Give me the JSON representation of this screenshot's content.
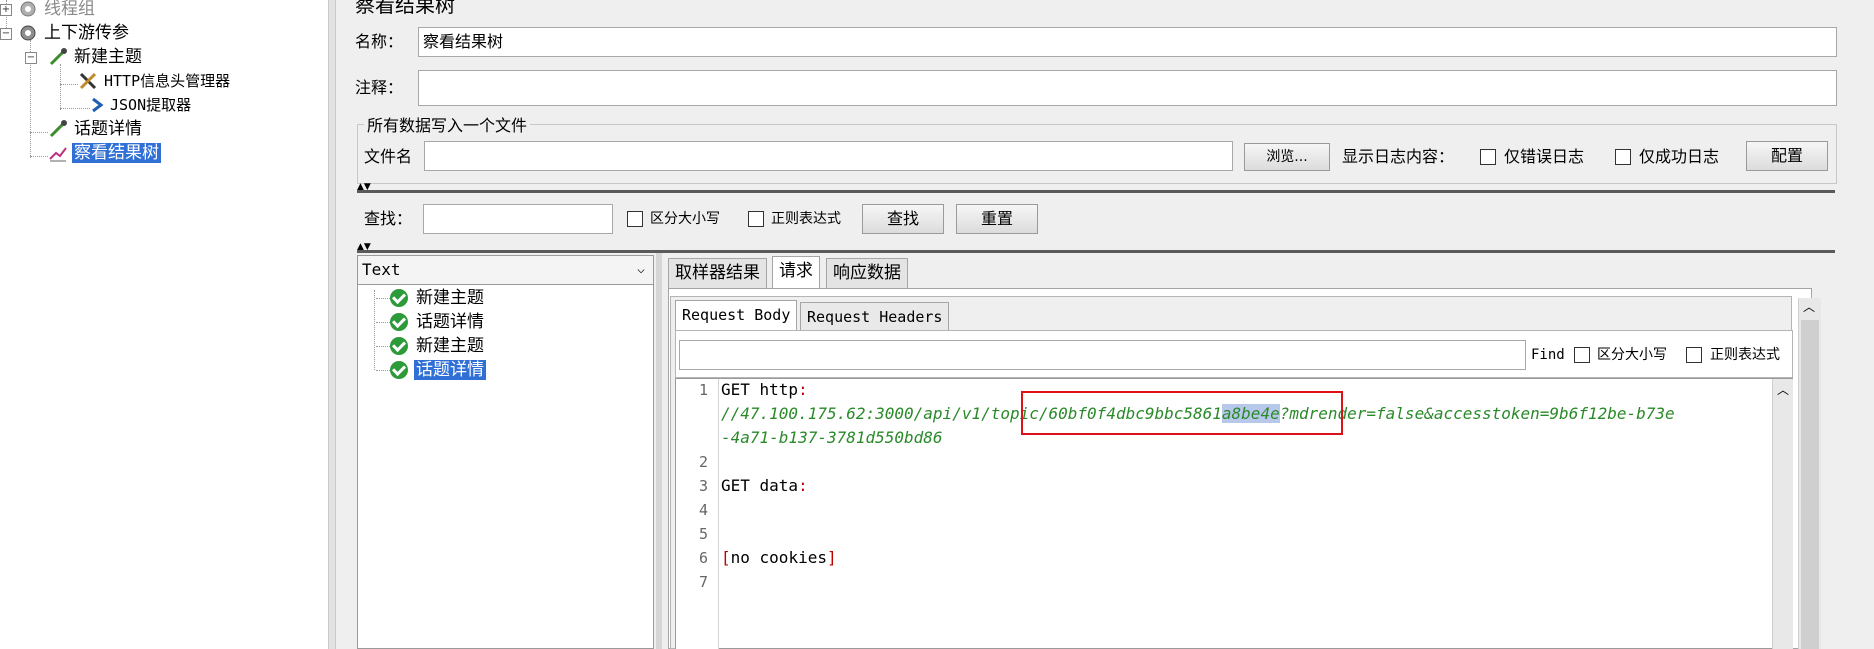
{
  "tree": {
    "nodes": [
      {
        "label": "线程组",
        "disabled": true
      },
      {
        "label": "上下游传参"
      },
      {
        "label": "新建主题"
      },
      {
        "label": "HTTP信息头管理器"
      },
      {
        "label": "JSON提取器"
      },
      {
        "label": "话题详情"
      },
      {
        "label": "察看结果树",
        "selected": true
      }
    ]
  },
  "panel": {
    "title": "察看结果树",
    "name_label": "名称：",
    "name_value": "察看结果树",
    "comment_label": "注释：",
    "comment_value": "",
    "file_group_title": "所有数据写入一个文件",
    "file_label": "文件名",
    "file_value": "",
    "browse_button": "浏览...",
    "log_label": "显示日志内容：",
    "errors_only": "仅错误日志",
    "success_only": "仅成功日志",
    "config_button": "配置"
  },
  "search": {
    "label": "查找：",
    "value": "",
    "case_sensitive": "区分大小写",
    "regex": "正则表达式",
    "find_button": "查找",
    "reset_button": "重置"
  },
  "results": {
    "renderer": "Text",
    "items": [
      {
        "label": "新建主题"
      },
      {
        "label": "话题详情"
      },
      {
        "label": "新建主题"
      },
      {
        "label": "话题详情",
        "selected": true
      }
    ]
  },
  "tabs": {
    "sampler_result": "取样器结果",
    "request": "请求",
    "response_data": "响应数据",
    "active": "请求"
  },
  "subtabs": {
    "body": "Request Body",
    "headers": "Request Headers",
    "active": "Request Body"
  },
  "find_bar": {
    "label": "Find",
    "case_sensitive": "区分大小写",
    "regex": "正则表达式",
    "value": ""
  },
  "editor": {
    "line_numbers": [
      "1",
      "2",
      "3",
      "4",
      "5",
      "6",
      "7"
    ],
    "line1_method": "GET http",
    "line1_colon": ":",
    "url_part_a": "//47.100.175.62:3000/api/v1/topic/60bf0f4dbc9bbc5861",
    "url_highlight": "a8be4e",
    "url_part_b": "?mdrender=false&accesstoken=9b6f12be-b73e",
    "url_line2": "-4a71-b137-3781d550bd86",
    "line3_text": "GET data",
    "line3_colon": ":",
    "line6_open": "[",
    "line6_text": "no cookies",
    "line6_close": "]"
  },
  "colors": {
    "selection": "#2f6fd6",
    "url_green": "#2a8a2a",
    "highlight_box": "#e0101a",
    "check_green": "#2c9a39"
  }
}
